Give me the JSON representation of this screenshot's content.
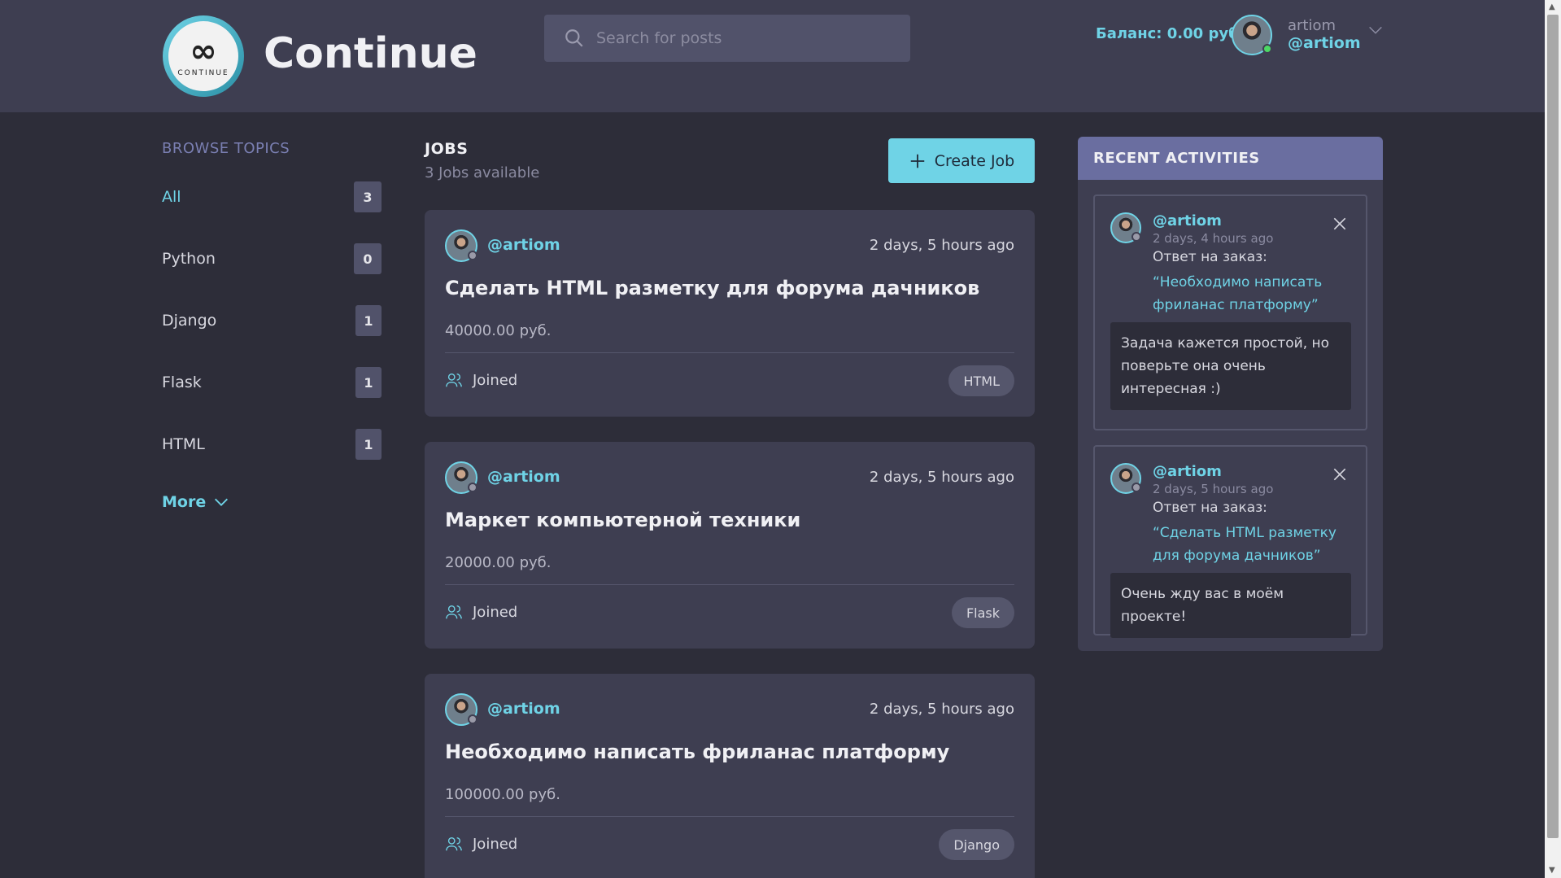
{
  "header": {
    "logo_text": "CONTINUE",
    "brand": "Continue",
    "search_placeholder": "Search for posts",
    "balance": "Баланс: 0.00 руб.",
    "user_name": "artiom",
    "user_handle": "@artiom"
  },
  "sidebar": {
    "title": "BROWSE TOPICS",
    "topics": [
      {
        "label": "All",
        "count": "3"
      },
      {
        "label": "Python",
        "count": "0"
      },
      {
        "label": "Django",
        "count": "1"
      },
      {
        "label": "Flask",
        "count": "1"
      },
      {
        "label": "HTML",
        "count": "1"
      }
    ],
    "more": "More"
  },
  "jobs": {
    "title": "JOBS",
    "subtitle": "3 Jobs available",
    "create_label": "Create Job",
    "items": [
      {
        "user": "@artiom",
        "time": "2 days, 5 hours ago",
        "title": "Сделать HTML разметку для форума дачников",
        "price": "40000.00 руб.",
        "joined": "Joined",
        "tag": "HTML"
      },
      {
        "user": "@artiom",
        "time": "2 days, 5 hours ago",
        "title": "Маркет компьютерной техники",
        "price": "20000.00 руб.",
        "joined": "Joined",
        "tag": "Flask"
      },
      {
        "user": "@artiom",
        "time": "2 days, 5 hours ago",
        "title": "Необходимо написать фриланас платформу",
        "price": "100000.00 руб.",
        "joined": "Joined",
        "tag": "Django"
      }
    ]
  },
  "recent": {
    "title": "RECENT ACTIVITIES",
    "items": [
      {
        "user": "@artiom",
        "time": "2 days, 4 hours ago",
        "label": "Ответ на заказ:",
        "link": "“Необходимо написать фриланас платформу”",
        "message": "Задача кажется простой, но поверьте она очень интересная :)"
      },
      {
        "user": "@artiom",
        "time": "2 days, 5 hours ago",
        "label": "Ответ на заказ:",
        "link": "“Сделать HTML разметку для форума дачников”",
        "message": "Очень жду вас в моём проекте!"
      }
    ]
  },
  "colors": {
    "accent": "#6fd3e6",
    "background": "#2d2d39",
    "panel": "#3e3e51",
    "recent_header": "#6a6ea0"
  }
}
